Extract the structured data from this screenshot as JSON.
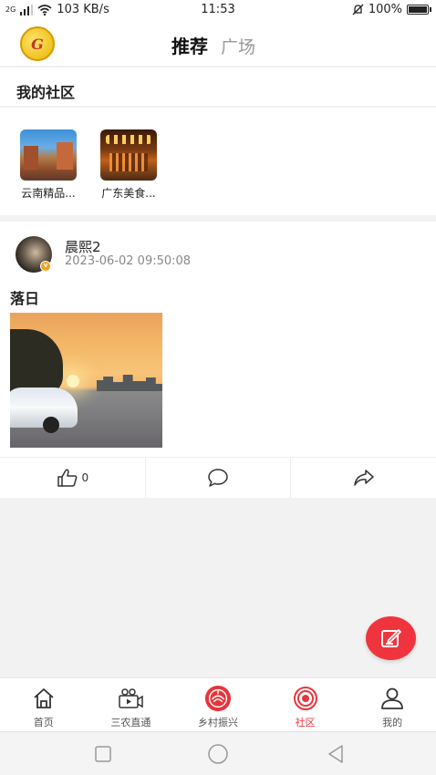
{
  "status_bar": {
    "network_type": "2G",
    "speed": "103 KB/s",
    "time": "11:53",
    "battery": "100%",
    "battery_level": 1.0
  },
  "header": {
    "tabs": [
      {
        "label": "推荐",
        "active": true
      },
      {
        "label": "广场",
        "active": false
      }
    ]
  },
  "my_community": {
    "title": "我的社区",
    "items": [
      {
        "name": "云南精品..."
      },
      {
        "name": "广东美食..."
      }
    ]
  },
  "post": {
    "author": "晨熙2",
    "time": "2023-06-02 09:50:08",
    "title": "落日",
    "likes": "0"
  },
  "bottom_nav": {
    "items": [
      {
        "label": "首页",
        "icon": "home-icon",
        "active": false
      },
      {
        "label": "三农直通",
        "icon": "video-camera-icon",
        "active": false
      },
      {
        "label": "乡村振兴",
        "icon": "rural-emblem-icon",
        "active": false
      },
      {
        "label": "社区",
        "icon": "community-icon",
        "active": true
      },
      {
        "label": "我的",
        "icon": "user-icon",
        "active": false
      }
    ]
  },
  "colors": {
    "accent": "#f0343e",
    "active_nav": "#e8343c",
    "muted_text": "#888888"
  }
}
